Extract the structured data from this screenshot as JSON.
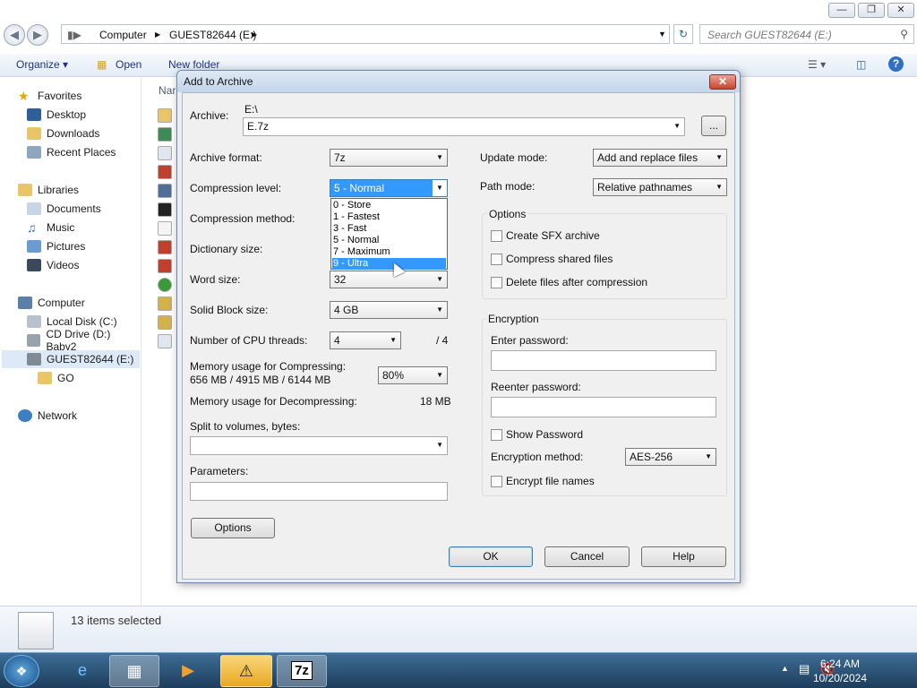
{
  "window": {
    "controls": [
      "—",
      "❐",
      "✕"
    ]
  },
  "address": {
    "segments": [
      "Computer",
      "GUEST82644 (E:)"
    ],
    "search_placeholder": "Search GUEST82644 (E:)"
  },
  "toolbar": {
    "organize": "Organize ▾",
    "open": "Open",
    "new_folder": "New folder"
  },
  "column_header": "Nar",
  "sidebar": {
    "favorites": "Favorites",
    "fav_items": [
      "Desktop",
      "Downloads",
      "Recent Places"
    ],
    "libraries": "Libraries",
    "lib_items": [
      "Documents",
      "Music",
      "Pictures",
      "Videos"
    ],
    "computer": "Computer",
    "comp_items": [
      "Local Disk (C:)",
      "CD Drive (D:) Baby2",
      "GUEST82644 (E:)"
    ],
    "go_folder": "GO",
    "network": "Network"
  },
  "status": {
    "text": "13 items selected"
  },
  "taskbar": {
    "time": "6:24 AM",
    "date": "10/20/2024",
    "sevenzip": "7z"
  },
  "dialog": {
    "title": "Add to Archive",
    "archive_label": "Archive:",
    "archive_path": "E:\\",
    "archive_name": "E.7z",
    "browse": "...",
    "archive_format_label": "Archive format:",
    "archive_format": "7z",
    "compression_level_label": "Compression level:",
    "compression_level": "5 - Normal",
    "compression_method_label": "Compression method:",
    "dictionary_size_label": "Dictionary size:",
    "word_size_label": "Word size:",
    "word_size": "32",
    "solid_block_label": "Solid Block size:",
    "solid_block": "4 GB",
    "cpu_threads_label": "Number of CPU threads:",
    "cpu_threads": "4",
    "cpu_threads_max": "/ 4",
    "mem_compress_label": "Memory usage for Compressing:",
    "mem_compress_value": "656 MB / 4915 MB / 6144 MB",
    "mem_percent": "80%",
    "mem_decompress_label": "Memory usage for Decompressing:",
    "mem_decompress_value": "18 MB",
    "split_label": "Split to volumes, bytes:",
    "parameters_label": "Parameters:",
    "options_button": "Options",
    "update_mode_label": "Update mode:",
    "update_mode": "Add and replace files",
    "path_mode_label": "Path mode:",
    "path_mode": "Relative pathnames",
    "options_group": "Options",
    "create_sfx": "Create SFX archive",
    "compress_shared": "Compress shared files",
    "delete_after": "Delete files after compression",
    "encryption_group": "Encryption",
    "enter_password": "Enter password:",
    "reenter_password": "Reenter password:",
    "show_password": "Show Password",
    "encryption_method_label": "Encryption method:",
    "encryption_method": "AES-256",
    "encrypt_names": "Encrypt file names",
    "ok": "OK",
    "cancel": "Cancel",
    "help": "Help",
    "level_options": [
      "0 - Store",
      "1 - Fastest",
      "3 - Fast",
      "5 - Normal",
      "7 - Maximum",
      "9 - Ultra"
    ],
    "highlighted_option": "9 - Ultra"
  },
  "colors": {
    "selection": "#3399ff",
    "taskbar": "#2a5177",
    "close": "#c7442f"
  }
}
